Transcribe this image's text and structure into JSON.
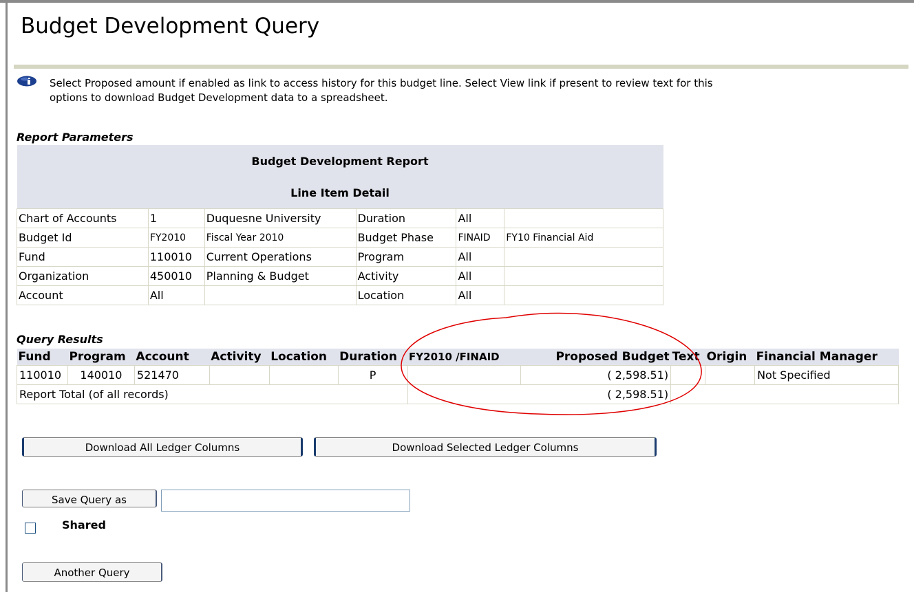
{
  "page": {
    "title": "Budget Development Query",
    "info_lines": [
      "Select Proposed amount if enabled as link to access history for this budget line. Select View link if present to review text for this",
      "options to download Budget Development data to a spreadsheet."
    ],
    "info_icon": "info-icon"
  },
  "parameters": {
    "section_label": "Report Parameters",
    "report_title": "Budget Development Report",
    "report_subtitle": "Line Item Detail",
    "rows": [
      [
        "Chart of Accounts",
        "1",
        "Duquesne University",
        "Duration",
        "All",
        ""
      ],
      [
        "Budget Id",
        "FY2010",
        "Fiscal Year 2010",
        "Budget Phase",
        "FINAID",
        "FY10 Financial Aid"
      ],
      [
        "Fund",
        "110010",
        "Current Operations",
        "Program",
        "All",
        ""
      ],
      [
        "Organization",
        "450010",
        "Planning & Budget",
        "Activity",
        "All",
        ""
      ],
      [
        "Account",
        "All",
        "",
        "Location",
        "All",
        ""
      ]
    ]
  },
  "results": {
    "section_label": "Query Results",
    "headers": [
      "Fund",
      "Program",
      "Account",
      "Activity",
      "Location",
      "Duration",
      "FY2010 /FINAID",
      "Proposed Budget",
      "Text",
      "Origin",
      "Financial Manager"
    ],
    "row": {
      "fund": "110010",
      "program": "140010",
      "account": "521470",
      "activity": "",
      "location": "",
      "duration": "P",
      "fy_finaid": "",
      "proposed": "( 2,598.51)",
      "text": "",
      "origin": "",
      "manager": "Not Specified"
    },
    "total_label": "Report Total (of all records)",
    "total_value": "( 2,598.51)"
  },
  "actions": {
    "download_all": "Download All Ledger Columns",
    "download_selected": "Download Selected Ledger Columns",
    "save_query": "Save Query as",
    "save_query_value": "",
    "shared_label": "Shared",
    "shared_checked": false,
    "another_query": "Another Query"
  },
  "colors": {
    "header_bg": "#e1e3ec",
    "title_rule": "#d6d7c2",
    "annotation": "#e00000"
  }
}
